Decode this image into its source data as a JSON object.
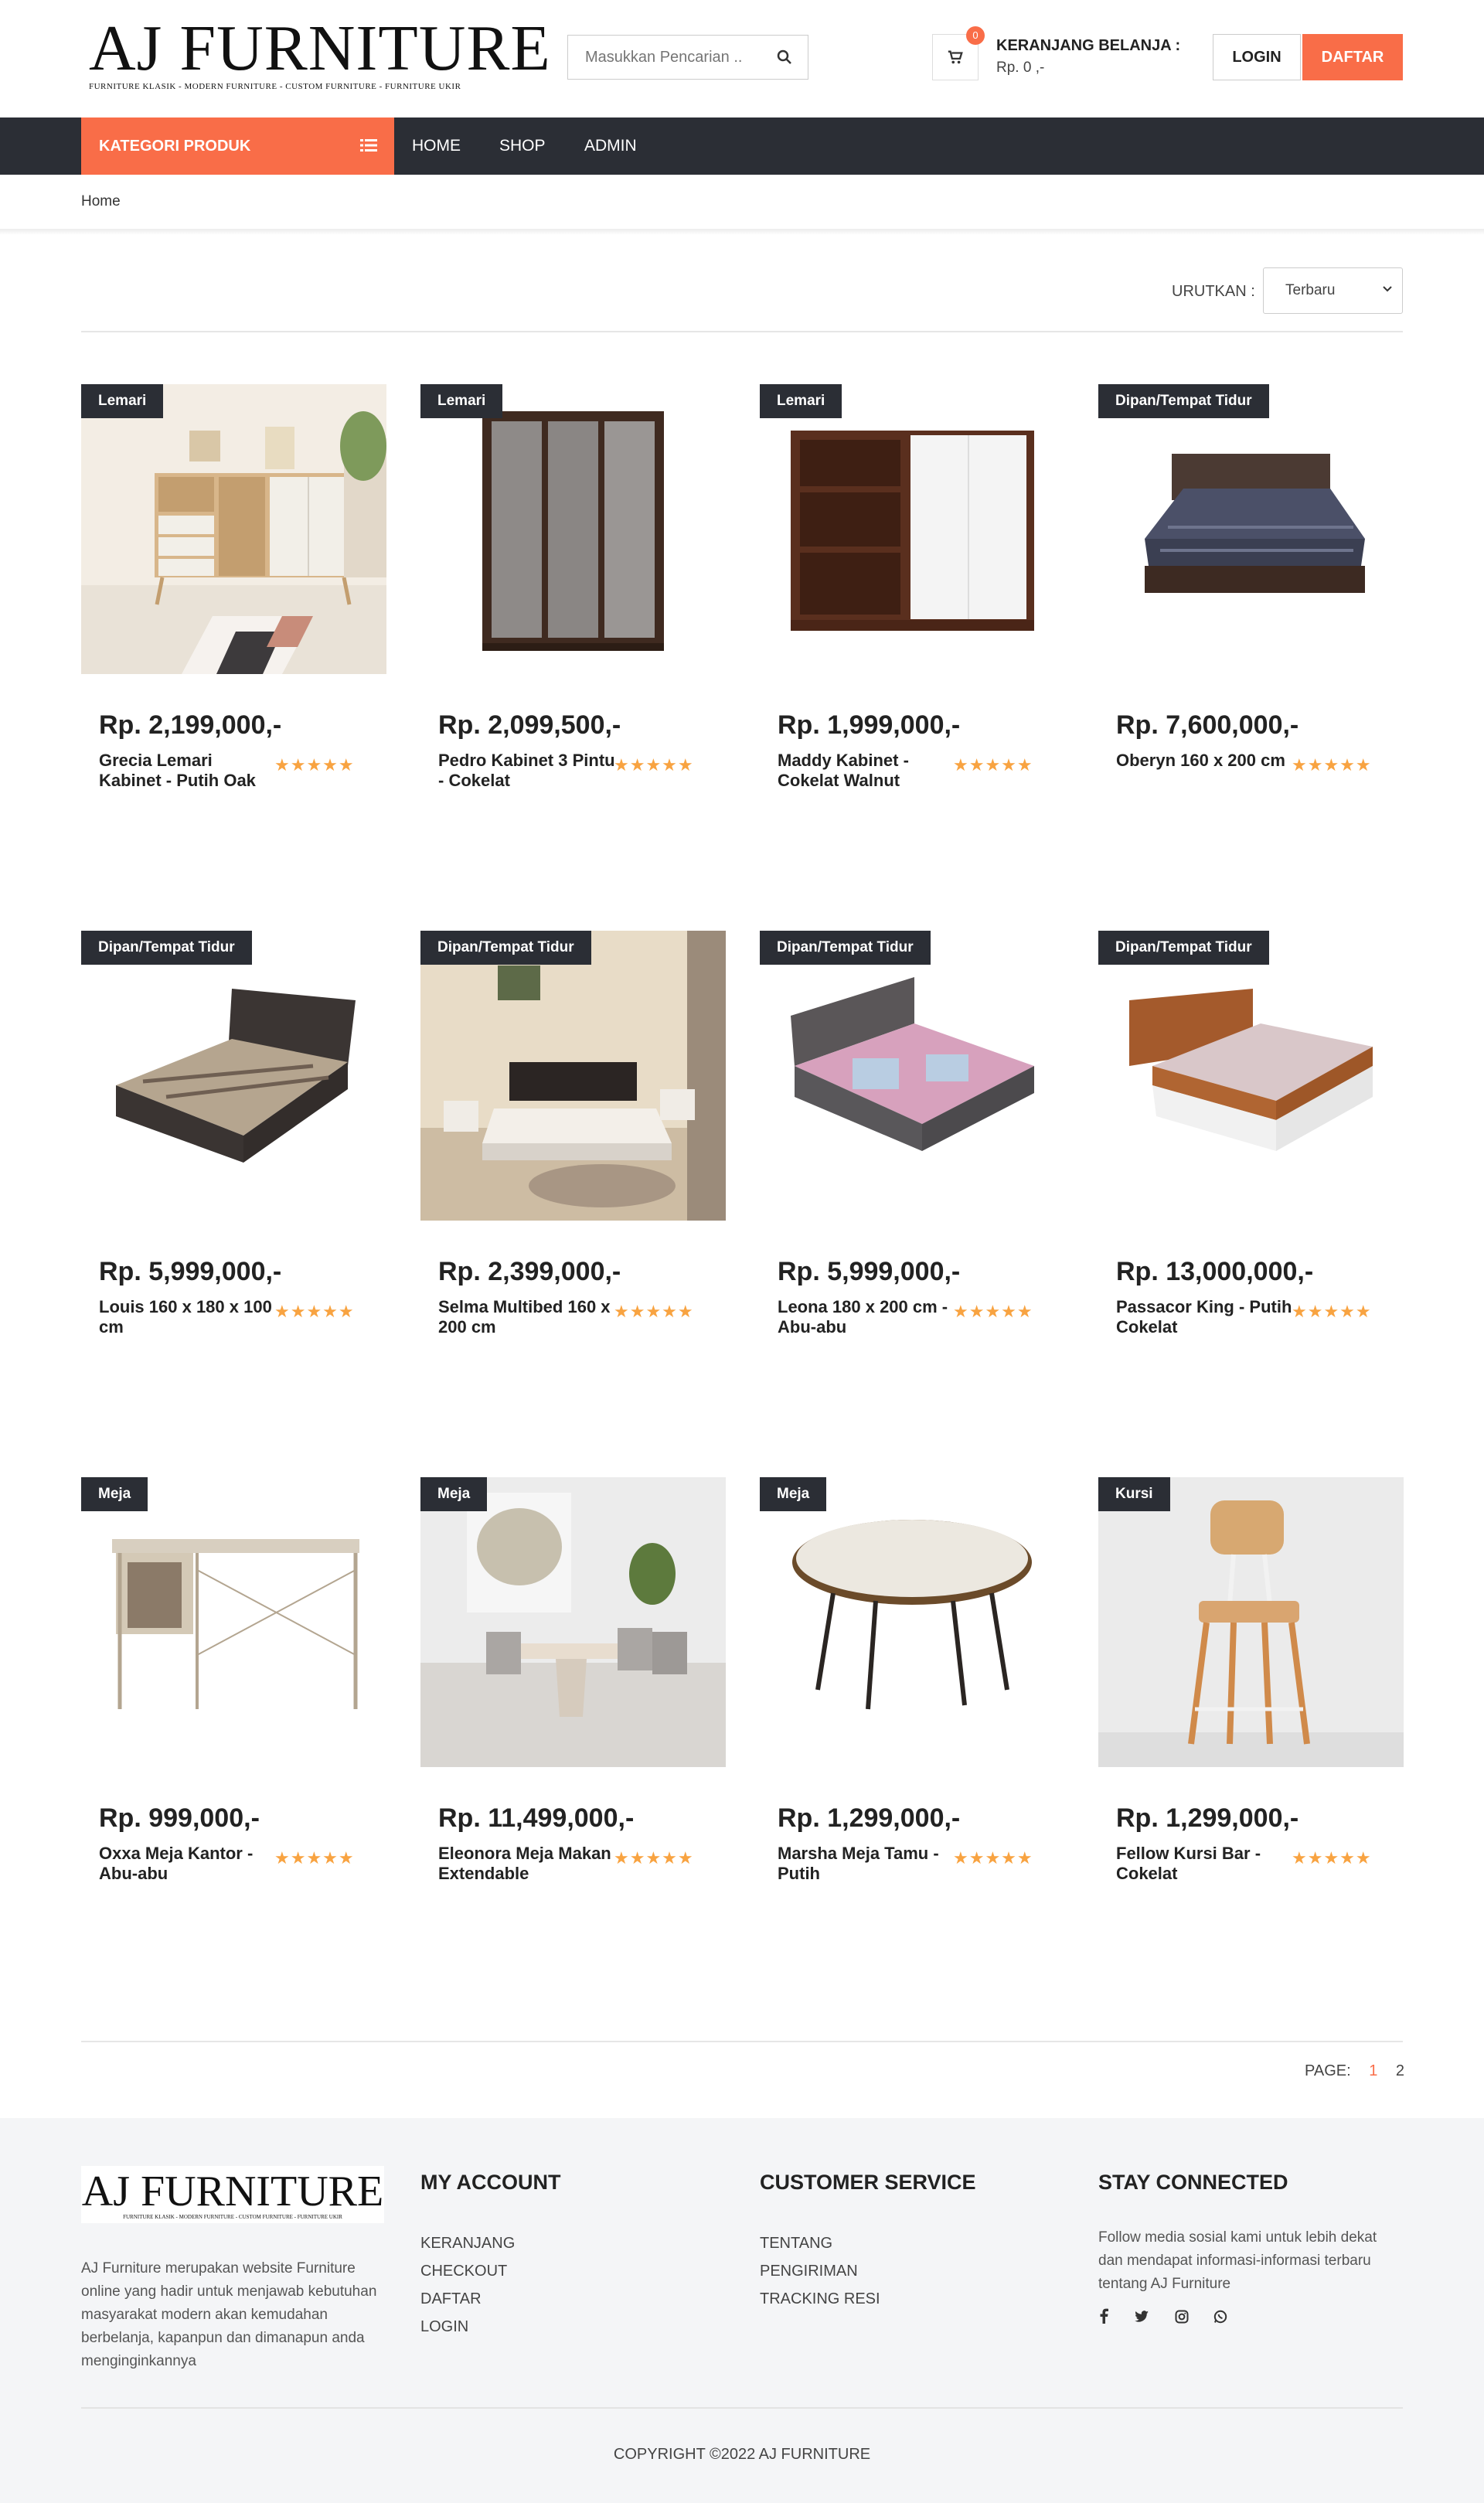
{
  "header": {
    "logo_title": "AJ FURNITURE",
    "logo_subtitle": "FURNITURE KLASIK - MODERN FURNITURE - CUSTOM FURNITURE - FURNITURE UKIR",
    "search_placeholder": "Masukkan Pencarian ..",
    "cart_count": "0",
    "cart_label": "KERANJANG BELANJA :",
    "cart_total": "Rp. 0 ,-",
    "login": "LOGIN",
    "daftar": "DAFTAR"
  },
  "nav": {
    "kategori": "KATEGORI PRODUK",
    "items": [
      "HOME",
      "SHOP",
      "ADMIN"
    ]
  },
  "breadcrumb": "Home",
  "sort": {
    "label": "URUTKAN :",
    "selected": "Terbaru"
  },
  "rating_stars": "★★★★★",
  "products": [
    {
      "category": "Lemari",
      "price": "Rp. 2,199,000,-",
      "name": "Grecia Lemari Kabinet - Putih Oak",
      "rating": 5
    },
    {
      "category": "Lemari",
      "price": "Rp. 2,099,500,-",
      "name": "Pedro Kabinet 3 Pintu - Cokelat",
      "rating": 5
    },
    {
      "category": "Lemari",
      "price": "Rp. 1,999,000,-",
      "name": "Maddy Kabinet - Cokelat Walnut",
      "rating": 5
    },
    {
      "category": "Dipan/Tempat Tidur",
      "price": "Rp. 7,600,000,-",
      "name": "Oberyn 160 x 200 cm",
      "rating": 5
    },
    {
      "category": "Dipan/Tempat Tidur",
      "price": "Rp. 5,999,000,-",
      "name": "Louis 160 x 180 x 100 cm",
      "rating": 5
    },
    {
      "category": "Dipan/Tempat Tidur",
      "price": "Rp. 2,399,000,-",
      "name": "Selma Multibed 160 x 200 cm",
      "rating": 5
    },
    {
      "category": "Dipan/Tempat Tidur",
      "price": "Rp. 5,999,000,-",
      "name": "Leona 180 x 200 cm - Abu-abu",
      "rating": 5
    },
    {
      "category": "Dipan/Tempat Tidur",
      "price": "Rp. 13,000,000,-",
      "name": "Passacor King - Putih Cokelat",
      "rating": 5
    },
    {
      "category": "Meja",
      "price": "Rp. 999,000,-",
      "name": "Oxxa Meja Kantor - Abu-abu",
      "rating": 5
    },
    {
      "category": "Meja",
      "price": "Rp. 11,499,000,-",
      "name": "Eleonora Meja Makan Extendable",
      "rating": 5
    },
    {
      "category": "Meja",
      "price": "Rp. 1,299,000,-",
      "name": "Marsha Meja Tamu - Putih",
      "rating": 5
    },
    {
      "category": "Kursi",
      "price": "Rp. 1,299,000,-",
      "name": "Fellow Kursi Bar - Cokelat",
      "rating": 5
    }
  ],
  "pagination": {
    "label": "PAGE:",
    "pages": [
      "1",
      "2"
    ],
    "active": "1"
  },
  "footer": {
    "logo_title": "AJ FURNITURE",
    "logo_subtitle": "FURNITURE KLASIK - MODERN FURNITURE - CUSTOM FURNITURE - FURNITURE UKIR",
    "description": "AJ Furniture merupakan website Furniture online yang hadir untuk menjawab kebutuhan masyarakat modern akan kemudahan berbelanja, kapanpun dan dimanapun anda menginginkannya",
    "my_account": {
      "title": "MY ACCOUNT",
      "links": [
        "KERANJANG",
        "CHECKOUT",
        "DAFTAR",
        "LOGIN"
      ]
    },
    "customer_service": {
      "title": "CUSTOMER SERVICE",
      "links": [
        "TENTANG",
        "PENGIRIMAN",
        "TRACKING RESI"
      ]
    },
    "stay_connected": {
      "title": "STAY CONNECTED",
      "text": "Follow media sosial kami untuk lebih dekat dan mendapat informasi-informasi terbaru tentang AJ Furniture",
      "icons": [
        "facebook-icon",
        "twitter-icon",
        "instagram-icon",
        "whatsapp-icon"
      ]
    },
    "copyright": "COPYRIGHT ©2022 AJ FURNITURE"
  },
  "colors": {
    "accent": "#f96d48",
    "dark": "#2b2e35",
    "star": "#f8a341"
  }
}
